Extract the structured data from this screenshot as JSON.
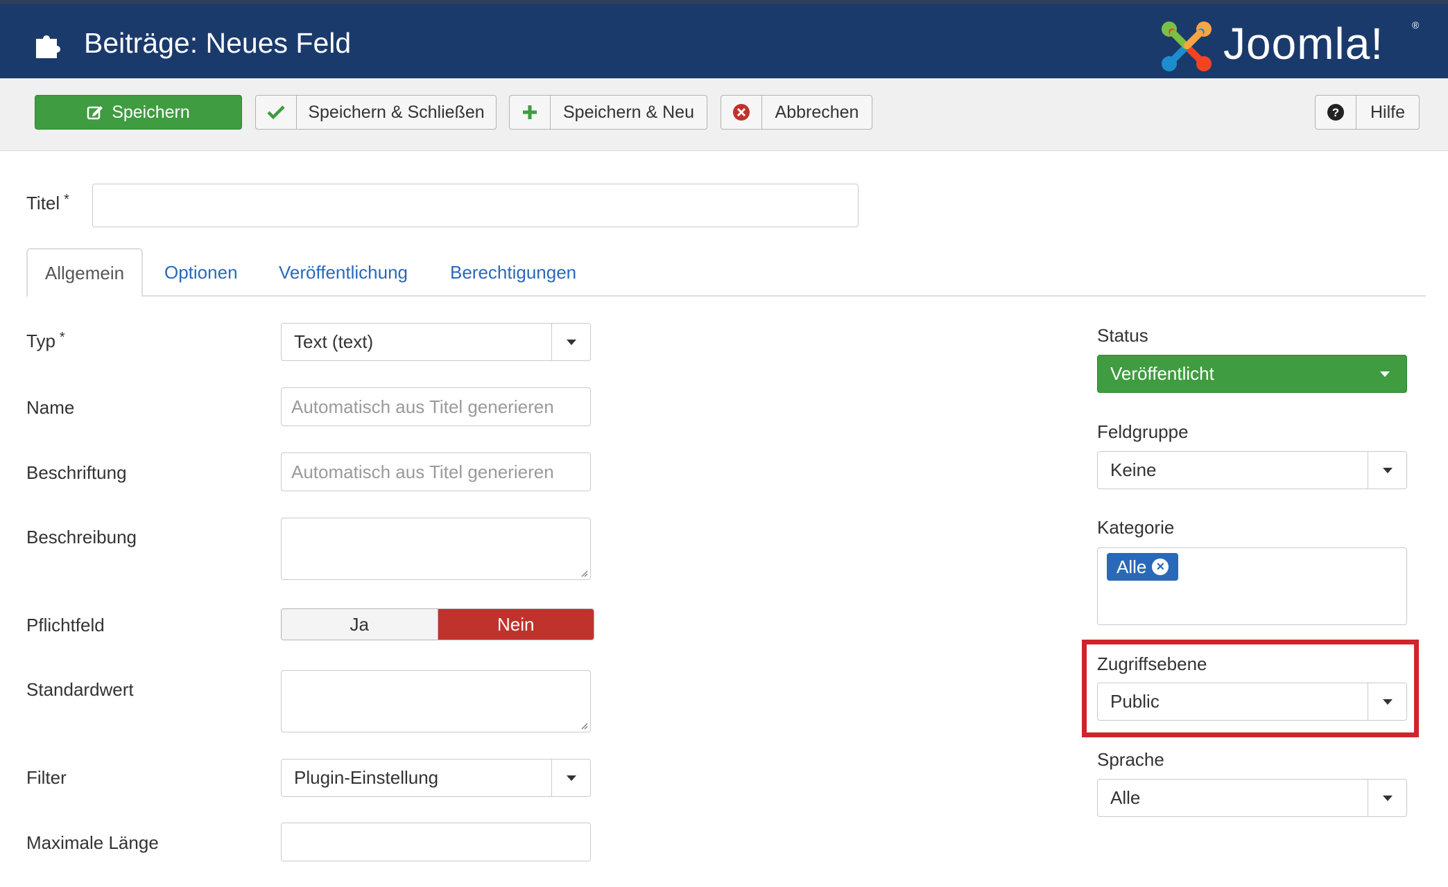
{
  "header": {
    "title": "Beiträge: Neues Feld",
    "logo_text": "Joomla!",
    "logo_reg": "®",
    "bg_color": "#1b3a6c"
  },
  "toolbar": {
    "save_label": "Speichern",
    "save_close_label": "Speichern & Schließen",
    "save_new_label": "Speichern & Neu",
    "cancel_label": "Abbrechen",
    "help_label": "Hilfe",
    "save_color": "#3f9c40"
  },
  "form": {
    "title_label": "Titel",
    "required_mark": "*",
    "title_value": ""
  },
  "tabs": [
    {
      "label": "Allgemein",
      "active": true
    },
    {
      "label": "Optionen",
      "active": false
    },
    {
      "label": "Veröffentlichung",
      "active": false
    },
    {
      "label": "Berechtigungen",
      "active": false
    }
  ],
  "fields": {
    "typ": {
      "label": "Typ",
      "value": "Text (text)"
    },
    "name": {
      "label": "Name",
      "placeholder": "Automatisch aus Titel generieren"
    },
    "beschriftung": {
      "label": "Beschriftung",
      "placeholder": "Automatisch aus Titel generieren"
    },
    "beschreibung": {
      "label": "Beschreibung",
      "value": ""
    },
    "pflichtfeld": {
      "label": "Pflichtfeld",
      "yes": "Ja",
      "no": "Nein",
      "selected": "Nein"
    },
    "standardwert": {
      "label": "Standardwert",
      "value": ""
    },
    "filter": {
      "label": "Filter",
      "value": "Plugin-Einstellung"
    },
    "maximale_laenge": {
      "label": "Maximale Länge",
      "value": ""
    }
  },
  "sidebar": {
    "status": {
      "label": "Status",
      "value": "Veröffentlicht"
    },
    "feldgruppe": {
      "label": "Feldgruppe",
      "value": "Keine"
    },
    "kategorie": {
      "label": "Kategorie",
      "chip": "Alle"
    },
    "zugriffsebene": {
      "label": "Zugriffsebene",
      "value": "Public",
      "highlight_color": "#d0232a"
    },
    "sprache": {
      "label": "Sprache",
      "value": "Alle"
    }
  },
  "icons": [
    "puzzle-icon",
    "joomla-logo-icon",
    "edit-icon",
    "check-icon",
    "plus-icon",
    "cancel-icon",
    "question-icon",
    "remove-chip-icon",
    "chevron-down-icon"
  ]
}
